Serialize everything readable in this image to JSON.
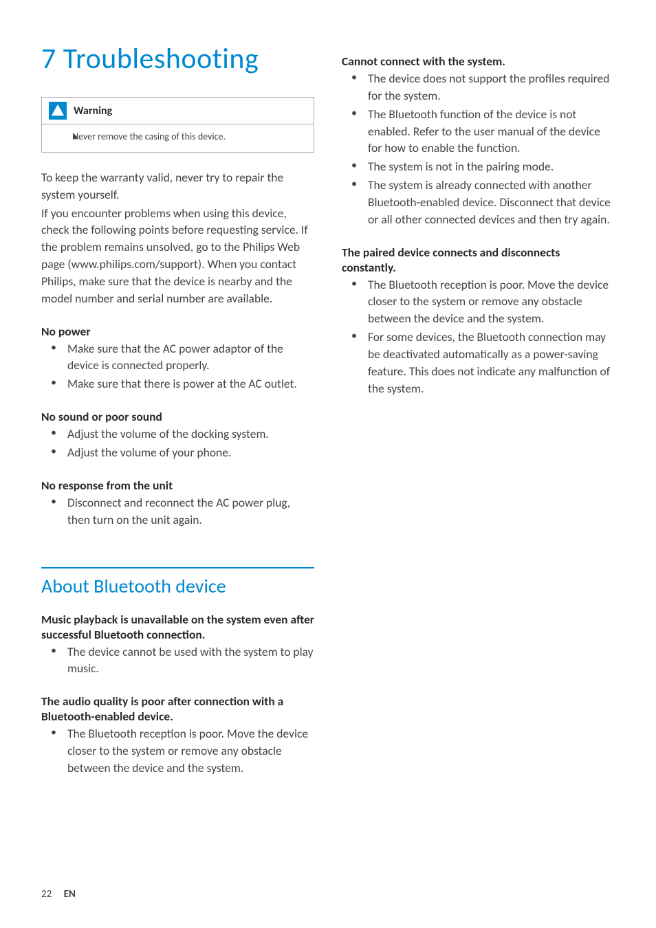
{
  "chapter": "7   Troubleshooting",
  "warning": {
    "label": "Warning",
    "items": [
      "Never remove the casing of this device."
    ]
  },
  "intro": {
    "p1": "To keep the warranty valid, never try to repair the system yourself.",
    "p2": "If you encounter problems when using this device, check the following points before requesting service. If the problem remains unsolved, go to the Philips Web page (www.philips.com/support). When you contact Philips, make sure that the device is nearby and the model number and serial number are available."
  },
  "left": {
    "h1": "No power",
    "b1": [
      "Make sure that the AC power adaptor of the device is connected properly.",
      "Make sure that there is power at the AC outlet."
    ],
    "h2": "No sound or poor sound",
    "b2": [
      "Adjust the volume of the docking system.",
      "Adjust the volume of your phone."
    ],
    "h3": "No response from the unit",
    "b3": [
      "Disconnect and reconnect the AC power plug, then turn on the unit again."
    ]
  },
  "section2": {
    "title": "About Bluetooth device",
    "h1": "Music playback is unavailable on the system even after successful Bluetooth connection.",
    "b1": [
      "The device cannot be used with the system to play music."
    ],
    "h2": "The audio quality is poor after connection with a Bluetooth-enabled device.",
    "b2": [
      "The Bluetooth reception is poor. Move the device closer to the system or remove any obstacle between the device and the system."
    ]
  },
  "right": {
    "h1": "Cannot connect with the system.",
    "b1": [
      "The device does not support the profiles required for the system.",
      "The Bluetooth function of the device is not enabled. Refer to the user manual of the device for how to enable the function.",
      "The system is not in the pairing mode.",
      "The system is already connected with another Bluetooth-enabled device. Disconnect that device or all other connected devices and then try again."
    ],
    "h2": "The paired device connects and disconnects constantly.",
    "b2": [
      "The Bluetooth reception is poor. Move the device closer to the system or remove any obstacle between the device and the system.",
      "For some devices, the Bluetooth connection may be deactivated automatically as a power-saving feature. This does not indicate any malfunction of the system."
    ]
  },
  "footer": {
    "page": "22",
    "lang": "EN"
  }
}
